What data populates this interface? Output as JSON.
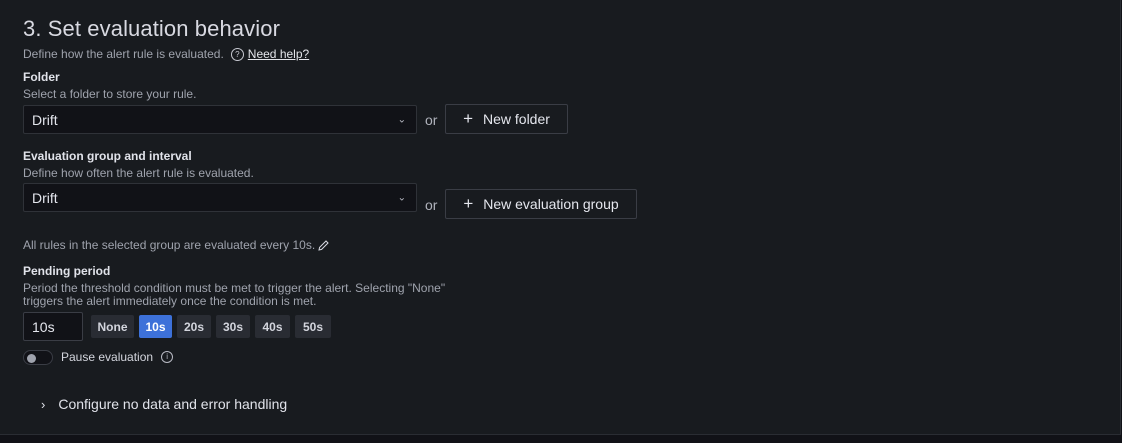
{
  "section": {
    "title": "3. Set evaluation behavior",
    "description": "Define how the alert rule is evaluated.",
    "help_link": "Need help?"
  },
  "folder": {
    "label": "Folder",
    "description": "Select a folder to store your rule.",
    "value": "Drift",
    "or_text": "or",
    "new_button": "New folder"
  },
  "group": {
    "label": "Evaluation group and interval",
    "description": "Define how often the alert rule is evaluated.",
    "value": "Drift",
    "or_text": "or",
    "new_button": "New evaluation group",
    "interval_note": "All rules in the selected group are evaluated every 10s."
  },
  "pending": {
    "label": "Pending period",
    "description_line1": "Period the threshold condition must be met to trigger the alert. Selecting \"None\"",
    "description_line2": "triggers the alert immediately once the condition is met.",
    "value": "10s",
    "options": [
      "None",
      "10s",
      "20s",
      "30s",
      "40s",
      "50s"
    ],
    "selected": "10s"
  },
  "pause": {
    "label": "Pause evaluation",
    "enabled": false
  },
  "no_data": {
    "label": "Configure no data and error handling"
  },
  "colors": {
    "accent": "#3d71d9",
    "background": "#181b1f"
  }
}
